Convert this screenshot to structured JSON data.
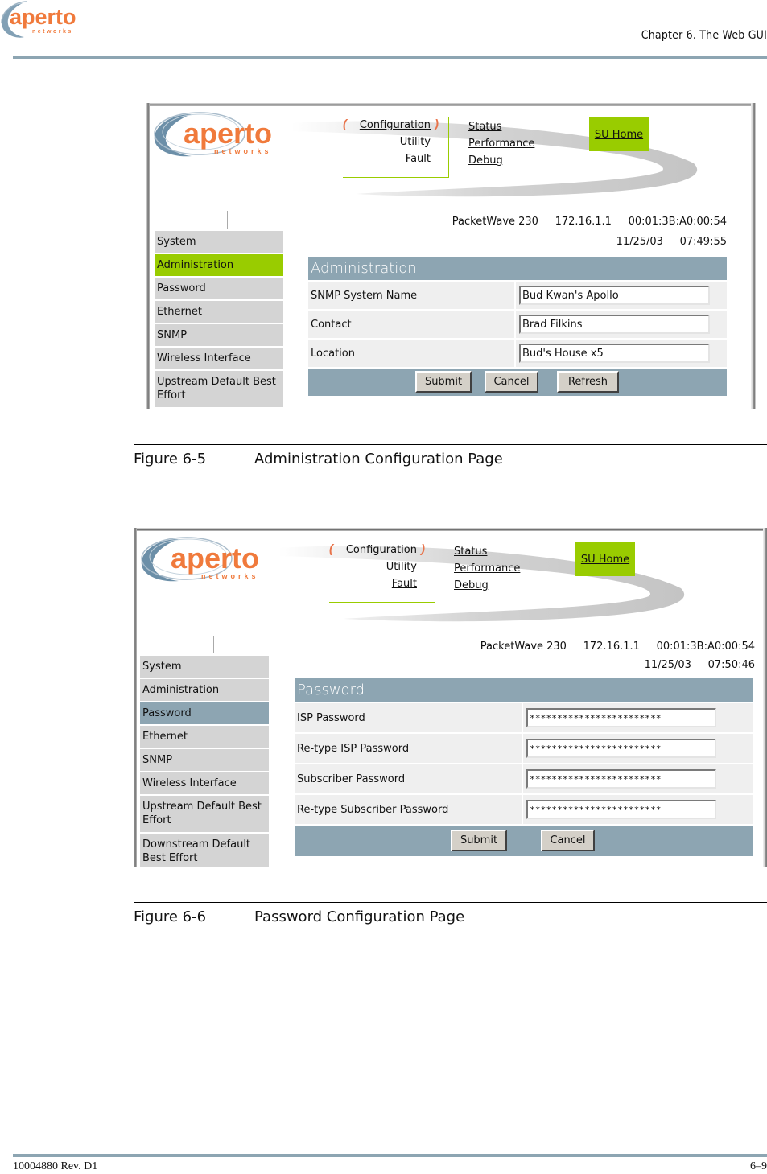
{
  "page_header": {
    "logo_text": "aperto",
    "logo_subtext": "networks",
    "chapter": "Chapter 6.  The Web GUI"
  },
  "figures": [
    {
      "caption_number": "Figure 6-5",
      "caption_title": "Administration Configuration Page",
      "screen": {
        "logo_text": "aperto",
        "logo_subtext": "networks",
        "nav_left": [
          "Configuration",
          "Utility",
          "Fault"
        ],
        "nav_right": [
          "Status",
          "Performance",
          "Debug"
        ],
        "su_home": "SU Home",
        "device_info_line1": "PacketWave 230     172.16.1.1     00:01:3B:A0:00:54",
        "device_info_line2": "11/25/03     07:49:55",
        "sidebar": [
          {
            "label": "System",
            "active": false
          },
          {
            "label": "Administration",
            "active": true
          },
          {
            "label": "Password",
            "active": false
          },
          {
            "label": "Ethernet",
            "active": false
          },
          {
            "label": "SNMP",
            "active": false
          },
          {
            "label": "Wireless Interface",
            "active": false
          },
          {
            "label": "Upstream Default Best Effort",
            "active": false
          }
        ],
        "panel_title": "Administration",
        "fields": [
          {
            "label": "SNMP System Name",
            "value": "Bud Kwan's Apollo"
          },
          {
            "label": "Contact",
            "value": "Brad Filkins"
          },
          {
            "label": "Location",
            "value": "Bud's House x5"
          }
        ],
        "buttons": [
          "Submit",
          "Cancel",
          "Refresh"
        ]
      }
    },
    {
      "caption_number": "Figure 6-6",
      "caption_title": "Password Configuration Page",
      "screen": {
        "logo_text": "aperto",
        "logo_subtext": "networks",
        "nav_left": [
          "Configuration",
          "Utility",
          "Fault"
        ],
        "nav_right": [
          "Status",
          "Performance",
          "Debug"
        ],
        "su_home": "SU Home",
        "device_info_line1": "PacketWave 230     172.16.1.1     00:01:3B:A0:00:54",
        "device_info_line2": "11/25/03     07:50:46",
        "sidebar": [
          {
            "label": "System",
            "active": false
          },
          {
            "label": "Administration",
            "active": false
          },
          {
            "label": "Password",
            "active": true
          },
          {
            "label": "Ethernet",
            "active": false
          },
          {
            "label": "SNMP",
            "active": false
          },
          {
            "label": "Wireless Interface",
            "active": false
          },
          {
            "label": "Upstream Default Best Effort",
            "active": false
          },
          {
            "label": "Downstream Default Best Effort",
            "active": false
          }
        ],
        "panel_title": "Password",
        "fields": [
          {
            "label": "ISP Password",
            "value": "************************"
          },
          {
            "label": "Re-type ISP Password",
            "value": "************************"
          },
          {
            "label": "Subscriber Password",
            "value": "************************"
          },
          {
            "label": "Re-type Subscriber Password",
            "value": "************************"
          }
        ],
        "buttons": [
          "Submit",
          "Cancel"
        ]
      }
    }
  ],
  "page_footer": {
    "doc_number": "10004880 Rev. D1",
    "page_number": "6–9"
  },
  "colors": {
    "brand_orange": "#f07a3c",
    "brand_blue": "#6c8fa8",
    "accent_green": "#99cc00",
    "panel_blue": "#8da5b2",
    "sidebar_gray": "#d4d4d4",
    "row_gray": "#efefef"
  }
}
